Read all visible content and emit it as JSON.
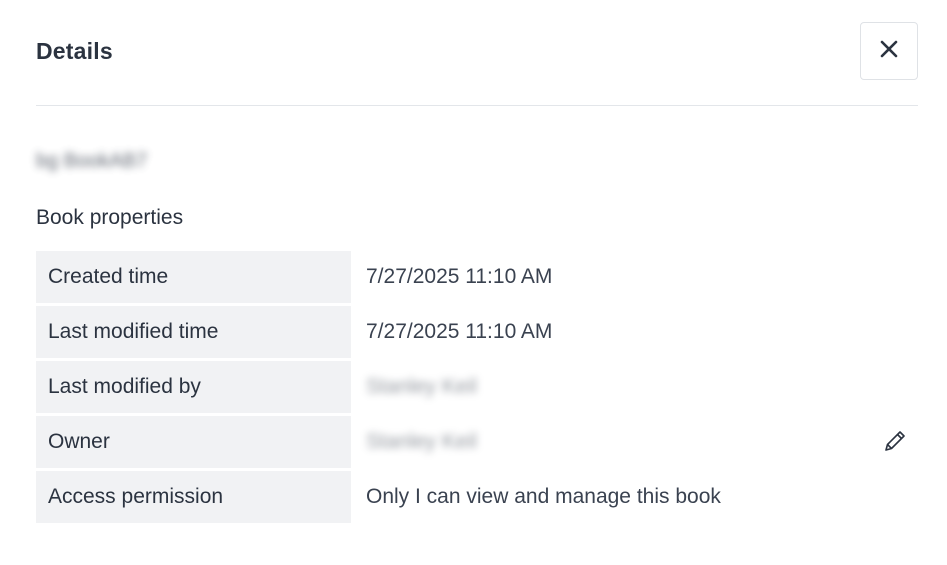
{
  "header": {
    "title": "Details",
    "close_icon": "close-icon"
  },
  "book": {
    "name": "bg BookAB7"
  },
  "section": {
    "heading": "Book properties"
  },
  "properties": [
    {
      "label": "Created time",
      "value": "7/27/2025 11:10 AM"
    },
    {
      "label": "Last modified time",
      "value": "7/27/2025 11:10 AM"
    },
    {
      "label": "Last modified by",
      "value": "Stanley Keil"
    },
    {
      "label": "Owner",
      "value": "Stanley Keil"
    },
    {
      "label": "Access permission",
      "value": "Only I can view and manage this book"
    }
  ],
  "owner_edit_icon": "pencil-icon"
}
